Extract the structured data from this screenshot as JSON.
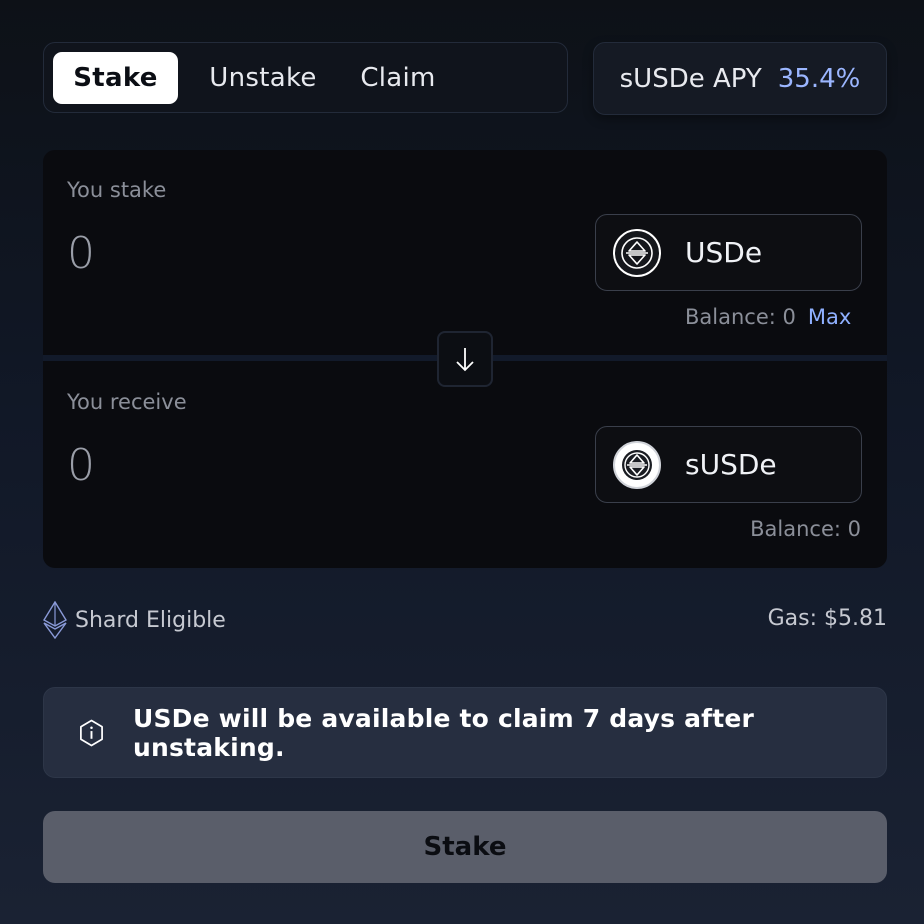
{
  "tabs": [
    {
      "label": "Stake",
      "active": true
    },
    {
      "label": "Unstake",
      "active": false
    },
    {
      "label": "Claim",
      "active": false
    }
  ],
  "apy": {
    "label": "sUSDe APY",
    "value": "35.4%"
  },
  "stake_section": {
    "label": "You stake",
    "amount": "0",
    "token": "USDe",
    "token_icon": "usde-coin-icon",
    "balance": "Balance: 0",
    "max_label": "Max"
  },
  "receive_section": {
    "label": "You receive",
    "amount": "0",
    "token": "sUSDe",
    "token_icon": "susde-coin-icon",
    "balance": "Balance: 0"
  },
  "swap_direction_icon": "arrow-down-icon",
  "shard": {
    "label": "Shard Eligible",
    "icon": "ethereum-diamond-icon"
  },
  "gas": "Gas: $5.81",
  "notice": {
    "icon": "info-hexagon-icon",
    "text": "USDe will be available to claim 7 days after unstaking."
  },
  "action_button": "Stake",
  "colors": {
    "accent": "#9bb6ff",
    "max_link": "#8fb0ff",
    "button_disabled": "#5a5e6a",
    "notice_bg": "#262e40"
  }
}
